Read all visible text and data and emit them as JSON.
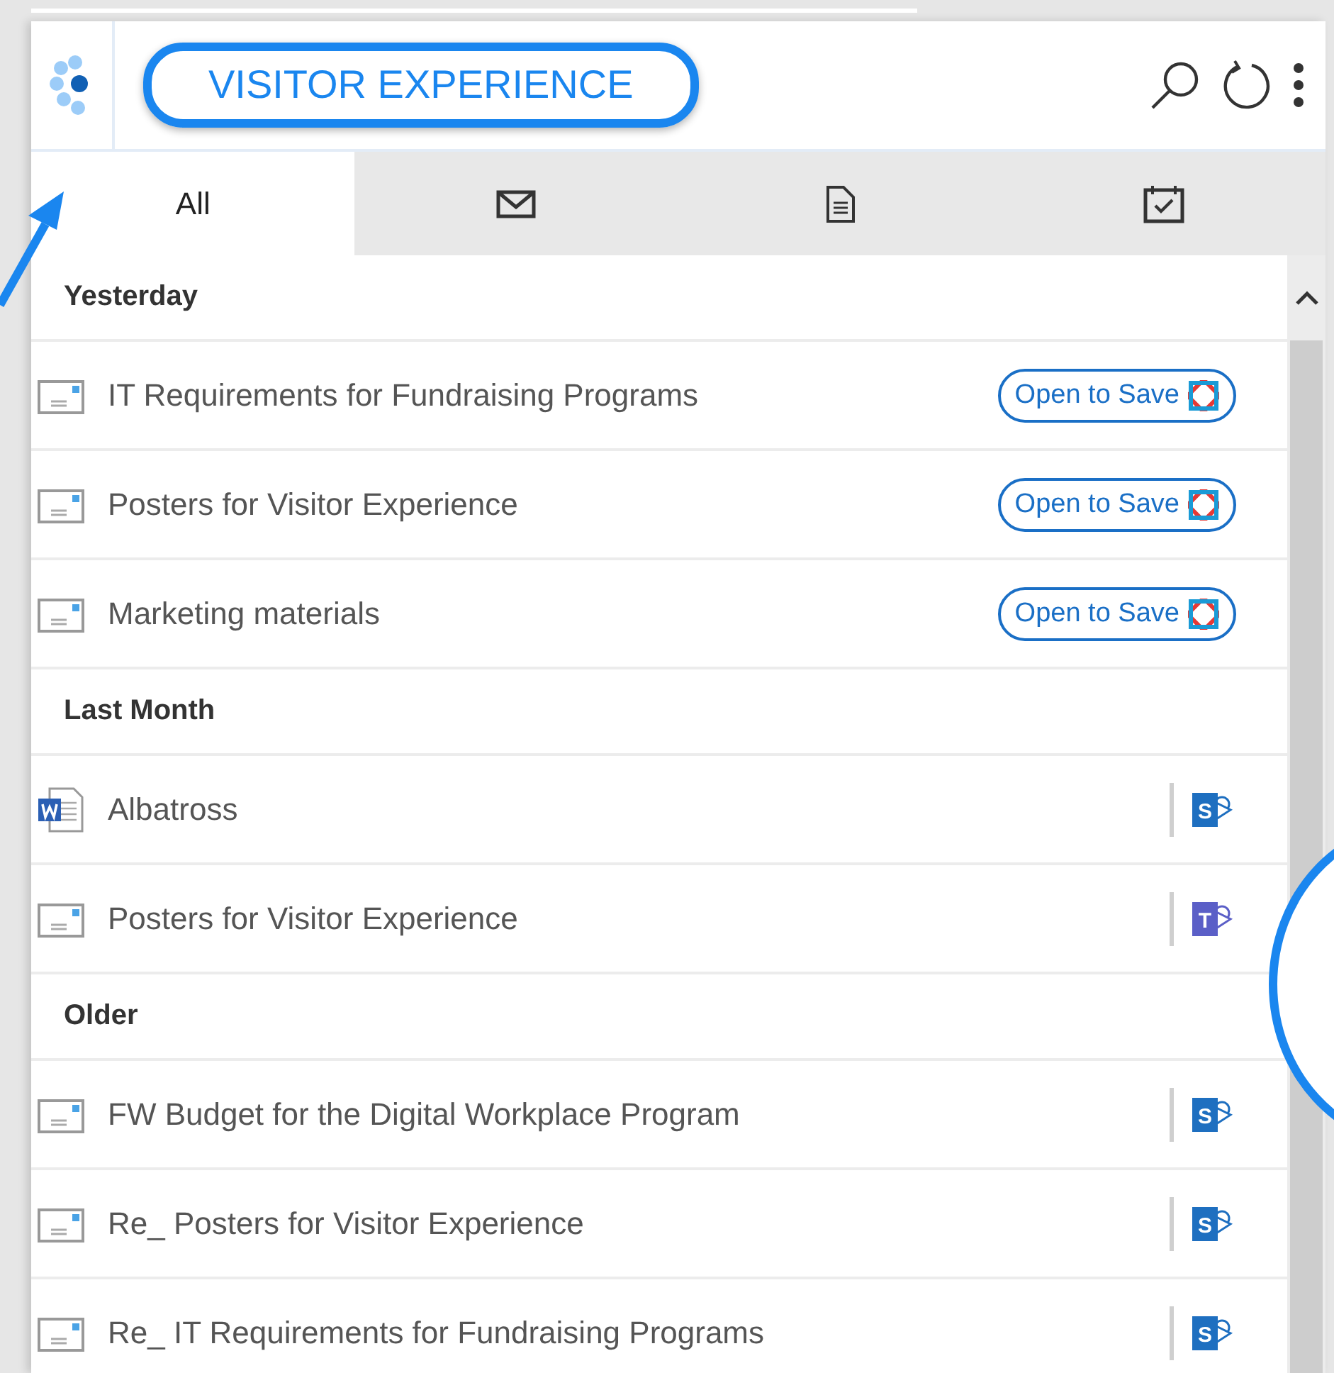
{
  "header": {
    "title": "VISITOR EXPERIENCE"
  },
  "tabs": [
    {
      "kind": "text",
      "label": "All",
      "selected": true
    },
    {
      "kind": "mail",
      "selected": false
    },
    {
      "kind": "document",
      "selected": false
    },
    {
      "kind": "calendar",
      "selected": false
    }
  ],
  "groups": [
    {
      "label": "Yesterday",
      "items": [
        {
          "kind": "email",
          "title": "IT Requirements for Fundraising Programs",
          "action": {
            "kind": "save",
            "label": "Open to Save"
          }
        },
        {
          "kind": "email",
          "title": "Posters for Visitor Experience",
          "action": {
            "kind": "save",
            "label": "Open to Save"
          }
        },
        {
          "kind": "email",
          "title": "Marketing materials",
          "action": {
            "kind": "save",
            "label": "Open to Save"
          }
        }
      ]
    },
    {
      "label": "Last Month",
      "items": [
        {
          "kind": "word",
          "title": "Albatross",
          "action": {
            "kind": "sharepoint",
            "letter": "S"
          }
        },
        {
          "kind": "email",
          "title": "Posters for Visitor Experience",
          "action": {
            "kind": "teams",
            "letter": "T"
          }
        }
      ]
    },
    {
      "label": "Older",
      "items": [
        {
          "kind": "email",
          "title": "FW Budget for the Digital Workplace Program",
          "action": {
            "kind": "sharepoint",
            "letter": "S"
          }
        },
        {
          "kind": "email",
          "title": "Re_ Posters for Visitor Experience",
          "action": {
            "kind": "sharepoint",
            "letter": "S"
          }
        },
        {
          "kind": "email",
          "title": "Re_ IT Requirements for Fundraising Programs",
          "action": {
            "kind": "sharepoint",
            "letter": "S"
          }
        }
      ]
    }
  ]
}
